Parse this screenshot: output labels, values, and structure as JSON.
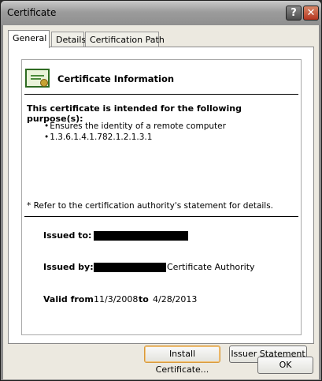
{
  "window": {
    "title": "Certificate"
  },
  "titlebar": {
    "help_glyph": "?",
    "close_glyph": "✕"
  },
  "tabs": [
    {
      "label": "General",
      "active": true
    },
    {
      "label": "Details",
      "active": false
    },
    {
      "label": "Certification Path",
      "active": false
    }
  ],
  "info": {
    "title": "Certificate Information",
    "purpose_heading": "This certificate is intended for the following purpose(s):",
    "purposes": [
      "Ensures the identity of a remote computer",
      "1.3.6.1.4.1.782.1.2.1.3.1"
    ],
    "refer_note": "* Refer to the certification authority's statement for details."
  },
  "fields": {
    "issued_to_label": "Issued to:",
    "issued_by_label": "Issued by:",
    "issued_by_suffix": "Certificate Authority",
    "valid_from_label": "Valid from",
    "valid_from": "11/3/2008",
    "to_label": "to",
    "valid_to": "4/28/2013"
  },
  "buttons": {
    "install": "Install Certificate...",
    "issuer": "Issuer Statement",
    "ok": "OK"
  },
  "colors": {
    "accent_button_border": "#d99a3a",
    "close_button": "#b4341f"
  }
}
